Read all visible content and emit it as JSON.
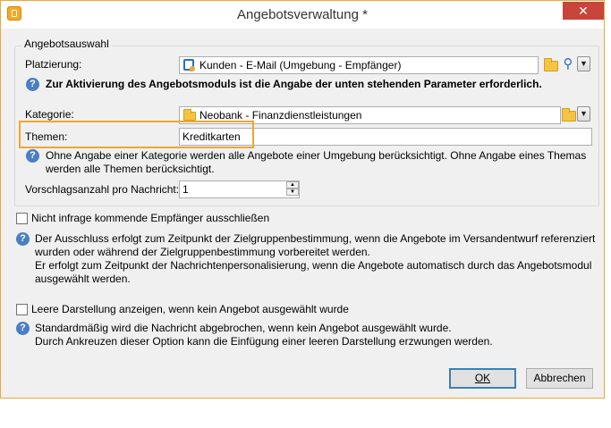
{
  "window": {
    "title": "Angebotsverwaltung *",
    "close_glyph": "✕"
  },
  "offer_selection": {
    "legend": "Angebotsauswahl",
    "placement_label": "Platzierung:",
    "placement_value": "Kunden - E-Mail (Umgebung - Empfänger)",
    "activation_note": "Zur Aktivierung des Angebotsmoduls ist die Angabe der unten stehenden Parameter erforderlich.",
    "category_label": "Kategorie:",
    "category_value": "Neobank - Finanzdienstleistungen",
    "themes_label": "Themen:",
    "themes_value": "Kreditkarten",
    "themes_note_line1": "Ohne Angabe einer Kategorie werden alle Angebote einer Umgebung berücksichtigt. Ohne Angabe eines Themas",
    "themes_note_line2": "werden alle Themen berücksichtigt.",
    "proposals_label": "Vorschlagsanzahl pro Nachricht:",
    "proposals_value": "1"
  },
  "exclude_option": {
    "label": "Nicht infrage kommende Empfänger ausschließen",
    "checked": false,
    "note_line1": "Der Ausschluss erfolgt zum Zeitpunkt der Zielgruppenbestimmung, wenn die Angebote im Versandentwurf referenziert",
    "note_line2": "wurden oder während der Zielgruppenbestimmung vorbereitet werden.",
    "note_line3": "Er erfolgt zum Zeitpunkt der Nachrichtenpersonalisierung, wenn die Angebote automatisch durch das Angebotsmodul",
    "note_line4": "ausgewählt werden."
  },
  "empty_option": {
    "label": "Leere Darstellung anzeigen, wenn kein Angebot ausgewählt wurde",
    "checked": false,
    "note_line1": "Standardmäßig wird die Nachricht abgebrochen, wenn kein Angebot ausgewählt wurde.",
    "note_line2": "Durch Ankreuzen dieser Option kann die Einfügung einer leeren Darstellung erzwungen werden."
  },
  "buttons": {
    "ok": "OK",
    "cancel": "Abbrechen"
  },
  "icons": {
    "info": "?",
    "dropdown": "▼",
    "spin_up": "▲",
    "spin_down": "▼",
    "search": "⚲"
  },
  "colors": {
    "highlight": "#f3a531",
    "info": "#4a7fc1",
    "close": "#c7453a"
  }
}
